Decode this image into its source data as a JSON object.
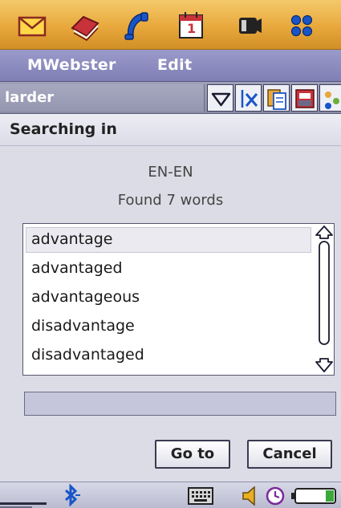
{
  "app": {
    "menu": [
      "MWebster",
      "Edit"
    ]
  },
  "topbar": {
    "icons": [
      "messaging-icon",
      "dictionary-icon",
      "phone-icon",
      "calendar-icon",
      "media-icon",
      "apps-grid-icon"
    ],
    "calendar_day": "1"
  },
  "search": {
    "value": "larder"
  },
  "toolbar": {
    "buttons": [
      "dropdown-icon",
      "clear-icon",
      "copy-icon",
      "paste-icon",
      "options-icon"
    ]
  },
  "section": {
    "title": "Searching in"
  },
  "results": {
    "dictionary": "EN-EN",
    "found": "Found 7 words",
    "words": [
      "advantage",
      "advantaged",
      "advantageous",
      "disadvantage",
      "disadvantaged"
    ],
    "selected": "advantage",
    "progress_value": ""
  },
  "buttons": {
    "goto": "Go to",
    "cancel": "Cancel"
  },
  "statusbar": {
    "icons": [
      "bluetooth-icon",
      "keyboard-icon",
      "volume-icon",
      "clock-icon",
      "battery-icon"
    ]
  },
  "colors": {
    "topbar": "#e8a83c",
    "menubar": "#7f7fb6",
    "toolbar": "#8a8ba6",
    "body": "#dcdce6",
    "accent_blue": "#1a55c8",
    "red": "#c8323a"
  }
}
